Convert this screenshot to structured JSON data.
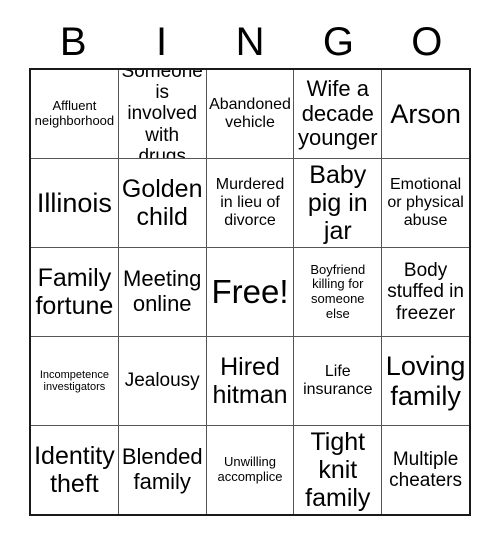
{
  "header": {
    "letters": [
      "B",
      "I",
      "N",
      "G",
      "O"
    ]
  },
  "grid": {
    "rows": [
      [
        {
          "text": "Affluent neighborhood",
          "size": "fs-sm"
        },
        {
          "text": "Someone is involved with drugs",
          "size": "fs-lg"
        },
        {
          "text": "Abandoned vehicle",
          "size": "fs-md"
        },
        {
          "text": "Wife a decade younger",
          "size": "fs-xl"
        },
        {
          "text": "Arson",
          "size": "fs-huge"
        }
      ],
      [
        {
          "text": "Illinois",
          "size": "fs-huge"
        },
        {
          "text": "Golden child",
          "size": "fs-xxl"
        },
        {
          "text": "Murdered in lieu of divorce",
          "size": "fs-md"
        },
        {
          "text": "Baby pig in jar",
          "size": "fs-xxl"
        },
        {
          "text": "Emotional or physical abuse",
          "size": "fs-md"
        }
      ],
      [
        {
          "text": "Family fortune",
          "size": "fs-xxl"
        },
        {
          "text": "Meeting online",
          "size": "fs-xl"
        },
        {
          "text": "Free!",
          "size": "fs-free"
        },
        {
          "text": "Boyfriend killing for someone else",
          "size": "fs-sm"
        },
        {
          "text": "Body stuffed in freezer",
          "size": "fs-lg"
        }
      ],
      [
        {
          "text": "Incompetence investigators",
          "size": "fs-xs"
        },
        {
          "text": "Jealousy",
          "size": "fs-lg"
        },
        {
          "text": "Hired hitman",
          "size": "fs-xxl"
        },
        {
          "text": "Life insurance",
          "size": "fs-md"
        },
        {
          "text": "Loving family",
          "size": "fs-huge"
        }
      ],
      [
        {
          "text": "Identity theft",
          "size": "fs-xxl"
        },
        {
          "text": "Blended family",
          "size": "fs-xl"
        },
        {
          "text": "Unwilling accomplice",
          "size": "fs-sm"
        },
        {
          "text": "Tight knit family",
          "size": "fs-xxl"
        },
        {
          "text": "Multiple cheaters",
          "size": "fs-lg"
        }
      ]
    ]
  },
  "colors": {
    "background": "#ffffff",
    "text": "#000000",
    "grid_line": "#555555",
    "grid_border": "#1a1a1a"
  }
}
